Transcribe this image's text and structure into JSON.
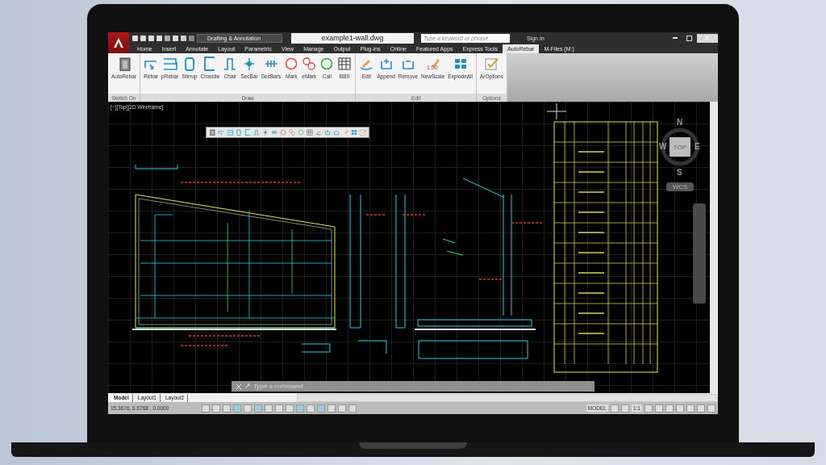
{
  "app_bar": {
    "workspace": "Drafting & Annotation",
    "file_title": "example1-wall.dwg",
    "search": {
      "placeholder": "Type a keyword or phrase"
    },
    "sign_in": "Sign In"
  },
  "ribbon_tabs": [
    {
      "label": "Home",
      "selected": false
    },
    {
      "label": "Insert",
      "selected": false
    },
    {
      "label": "Annotate",
      "selected": false
    },
    {
      "label": "Layout",
      "selected": false
    },
    {
      "label": "Parametric",
      "selected": false
    },
    {
      "label": "View",
      "selected": false
    },
    {
      "label": "Manage",
      "selected": false
    },
    {
      "label": "Output",
      "selected": false
    },
    {
      "label": "Plug-ins",
      "selected": false
    },
    {
      "label": "Online",
      "selected": false
    },
    {
      "label": "Featured Apps",
      "selected": false
    },
    {
      "label": "Express Tools",
      "selected": false
    },
    {
      "label": "AutoRebar",
      "selected": true
    },
    {
      "label": "M-Files (M:)",
      "selected": false
    }
  ],
  "ribbon_panels": [
    {
      "title": "Switch On",
      "buttons": [
        {
          "label": "AutoRebar"
        }
      ]
    },
    {
      "title": "Draw",
      "buttons": [
        {
          "label": "Rebar"
        },
        {
          "label": "pRebar"
        },
        {
          "label": "Stirrup"
        },
        {
          "label": "Crosstie"
        },
        {
          "label": "Chair"
        },
        {
          "label": "SecBar"
        },
        {
          "label": "SecBars"
        },
        {
          "label": "Mark"
        },
        {
          "label": "eMark"
        },
        {
          "label": "Call"
        },
        {
          "label": "BBS"
        }
      ]
    },
    {
      "title": "Edit",
      "buttons": [
        {
          "label": "Edit"
        },
        {
          "label": "Append"
        },
        {
          "label": "Remove"
        },
        {
          "label": "NewScale",
          "icon_text": "1:50"
        },
        {
          "label": "ExplodeAll"
        }
      ]
    },
    {
      "title": "Options",
      "buttons": [
        {
          "label": "ArOptions"
        }
      ]
    }
  ],
  "viewport": {
    "label": "[−][Top][2D Wireframe]",
    "compass": {
      "north": "N",
      "west": "W",
      "top": "TOP",
      "east": "E",
      "south": "S",
      "ucs": "WCS"
    }
  },
  "command_line": {
    "placeholder": "Type a command"
  },
  "layout_tabs": [
    {
      "label": "Model",
      "selected": true
    },
    {
      "label": "Layout1",
      "selected": false
    },
    {
      "label": "Layout2",
      "selected": false
    }
  ],
  "status_bar": {
    "coordinates": "15.3676, 6.6768 , 0.0000",
    "model": "MODEL",
    "scale": "1:1"
  }
}
